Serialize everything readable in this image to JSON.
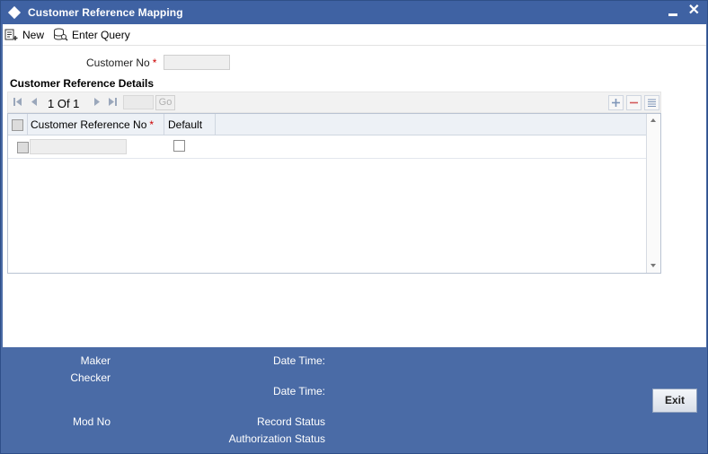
{
  "window": {
    "title": "Customer Reference Mapping"
  },
  "toolbar": {
    "new_label": "New",
    "enter_query_label": "Enter Query"
  },
  "form": {
    "customer_no_label": "Customer No",
    "required_mark": "*",
    "customer_no_value": ""
  },
  "section": {
    "title": "Customer Reference Details"
  },
  "pager": {
    "text": "1 Of 1",
    "page_input": "",
    "go_label": "Go"
  },
  "grid": {
    "columns": [
      {
        "label": "Customer Reference No",
        "required": "*"
      },
      {
        "label": "Default"
      }
    ],
    "rows": [
      {
        "customer_reference_no": "",
        "default": false
      }
    ]
  },
  "footer": {
    "maker_label": "Maker",
    "checker_label": "Checker",
    "date_time_label": "Date Time:",
    "date_time_label_2": "Date Time:",
    "mod_no_label": "Mod No",
    "record_status_label": "Record Status",
    "authorization_status_label": "Authorization Status",
    "exit_label": "Exit"
  },
  "colors": {
    "titlebar": "#3f62a3",
    "frame": "#4a6ba6",
    "required": "#cc0000"
  }
}
